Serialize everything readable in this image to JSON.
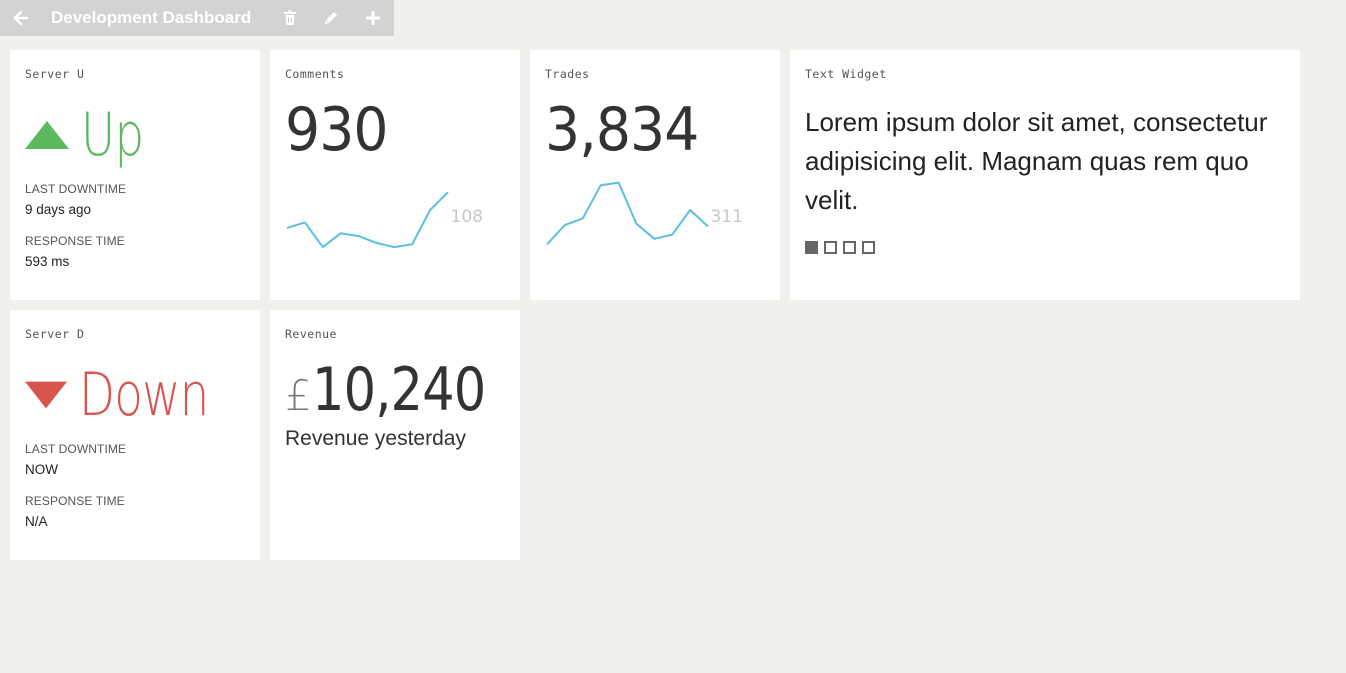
{
  "header": {
    "title": "Development Dashboard",
    "back_icon": "arrow-left-icon",
    "tools": [
      "trash-icon",
      "pencil-icon",
      "plus-icon"
    ]
  },
  "colors": {
    "up": "#5cb85c",
    "down": "#d9534f",
    "sparkline": "#5bc0de",
    "background": "#f0f0ec"
  },
  "widgets": {
    "server_u": {
      "title": "Server U",
      "status": "Up",
      "status_icon": "triangle-up-icon",
      "downtime_label": "LAST DOWNTIME",
      "downtime_value": "9 days ago",
      "response_label": "RESPONSE TIME",
      "response_value": "593 ms"
    },
    "comments": {
      "title": "Comments",
      "value": "930",
      "last": "108",
      "series": [
        30,
        34,
        16,
        26,
        24,
        19,
        16,
        18,
        43,
        56
      ]
    },
    "trades": {
      "title": "Trades",
      "value": "3,834",
      "last": "311",
      "series": [
        18,
        32,
        37,
        61,
        63,
        33,
        22,
        25,
        43,
        31
      ]
    },
    "text_widget": {
      "title": "Text Widget",
      "body": "Lorem ipsum dolor sit amet, consectetur adipisicing elit. Magnam quas rem quo velit.",
      "pages": 4,
      "active_page": 1
    },
    "server_d": {
      "title": "Server D",
      "status": "Down",
      "status_icon": "triangle-down-icon",
      "downtime_label": "LAST DOWNTIME",
      "downtime_value": "NOW",
      "response_label": "RESPONSE TIME",
      "response_value": "N/A"
    },
    "revenue": {
      "title": "Revenue",
      "prefix": "£",
      "value": "10,240",
      "caption": "Revenue yesterday"
    }
  }
}
